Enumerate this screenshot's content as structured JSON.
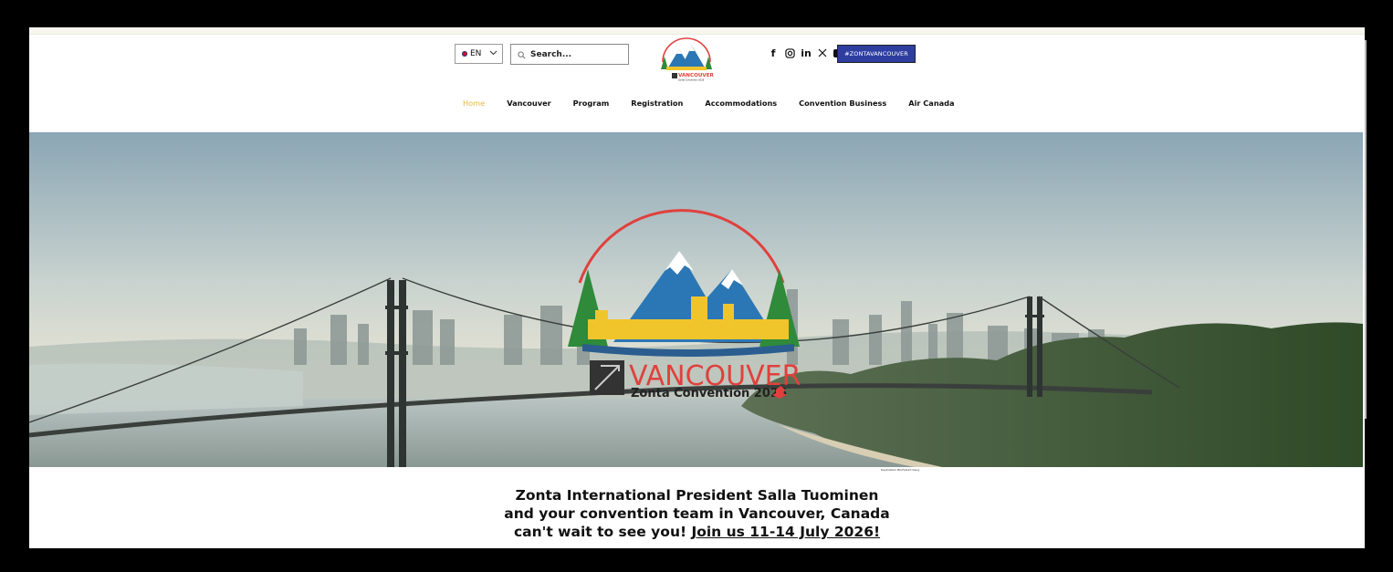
{
  "language": {
    "current": "EN",
    "flag_icon": "flag-icon"
  },
  "search": {
    "placeholder": "Search..."
  },
  "logo": {
    "line1": "VANCOUVER",
    "line2": "Zonta Convention 2026"
  },
  "social": {
    "icons": [
      "facebook-icon",
      "instagram-icon",
      "linkedin-icon",
      "x-icon",
      "youtube-icon"
    ],
    "hashtag": "#ZONTAVANCOUVER"
  },
  "nav": {
    "items": [
      "Home",
      "Vancouver",
      "Program",
      "Registration",
      "Accommodations",
      "Convention Business",
      "Air Canada"
    ],
    "active": "Home"
  },
  "hero": {
    "logo_title": "VANCOUVER",
    "logo_subtitle": "Zonta Convention 2026",
    "photo_credit": "Destination BC/Hubert Kang"
  },
  "intro": {
    "line1": "Zonta International President Salla Tuominen",
    "line2": "and your convention team in Vancouver, Canada",
    "line3_prefix": "can't wait to see you! ",
    "line3_link": "Join us 11-14 July 2026!"
  },
  "colors": {
    "accent_nav": "#e6b83c",
    "hashtag_bg": "#2e3ea0",
    "logo_red": "#e0413d",
    "logo_yellow": "#f0c52c",
    "logo_blue": "#2b77b5",
    "logo_green": "#2f8a3a"
  }
}
